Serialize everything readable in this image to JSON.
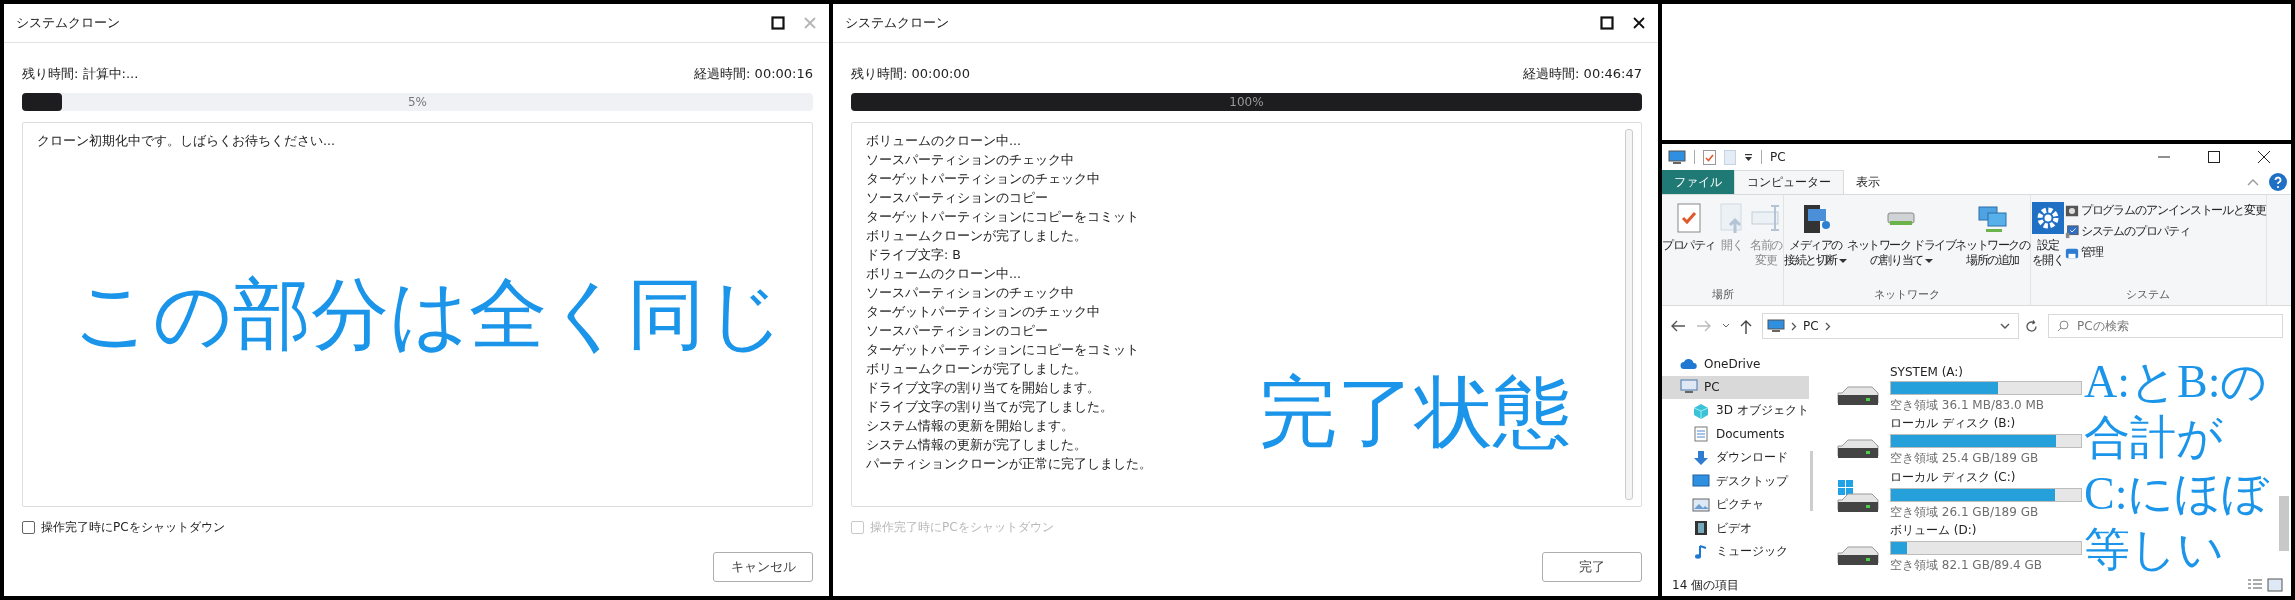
{
  "clone_windows": [
    {
      "title": "システムクローン",
      "close_disabled": true,
      "remaining_label": "残り時間:",
      "remaining_value": "計算中:...",
      "elapsed_label": "経過時間:",
      "elapsed_value": "00:00:16",
      "progress": {
        "level": 0.05,
        "label": "5%"
      },
      "log": [
        "クローン初期化中です。しばらくお待ちください..."
      ],
      "shutdown_option": {
        "label": "操作完了時にPCをシャットダウン",
        "checked": false,
        "disabled": false
      },
      "button": "キャンセル",
      "annotation": "この部分は全く同じ",
      "scrollbar": false
    },
    {
      "title": "システムクローン",
      "close_disabled": false,
      "remaining_label": "残り時間:",
      "remaining_value": "00:00:00",
      "elapsed_label": "経過時間:",
      "elapsed_value": "00:46:47",
      "progress": {
        "level": 1,
        "label": "100%"
      },
      "log": [
        "ボリュームのクローン中...",
        "ソースパーティションのチェック中",
        "ターゲットパーティションのチェック中",
        "ソースパーティションのコピー",
        "ターゲットパーティションにコピーをコミット",
        "ボリュームクローンが完了しました。",
        "ドライブ文字: B",
        "ボリュームのクローン中...",
        "ソースパーティションのチェック中",
        "ターゲットパーティションのチェック中",
        "ソースパーティションのコピー",
        "ターゲットパーティションにコピーをコミット",
        "ボリュームクローンが完了しました。",
        "ドライブ文字の割り当てを開始します。",
        "ドライブ文字の割り当てが完了しました。",
        "システム情報の更新を開始します。",
        "システム情報の更新が完了しました。",
        "パーティションクローンが正常に完了しました。"
      ],
      "shutdown_option": {
        "label": "操作完了時にPCをシャットダウン",
        "checked": false,
        "disabled": true
      },
      "button": "完了",
      "annotation": "完了状態",
      "scrollbar": true
    }
  ],
  "explorer": {
    "title": "PC",
    "tabs": [
      {
        "label": "ファイル",
        "kind": "file",
        "selected": false
      },
      {
        "label": "コンピューター",
        "kind": "tab",
        "selected": true
      },
      {
        "label": "表示",
        "kind": "tab",
        "selected": false
      }
    ],
    "ribbon_groups": [
      {
        "label": "場所",
        "large_items": [
          {
            "lines": [
              "プロパティ"
            ],
            "disabled": false,
            "dropdown": false
          },
          {
            "lines": [
              "開く"
            ],
            "disabled": true,
            "dropdown": false
          },
          {
            "lines": [
              "名前の",
              "変更"
            ],
            "disabled": true,
            "dropdown": false
          }
        ]
      },
      {
        "label": "ネットワーク",
        "large_items": [
          {
            "lines": [
              "メディアの",
              "接続と切断"
            ],
            "disabled": false,
            "dropdown": true
          },
          {
            "lines": [
              "ネットワーク ドライブ",
              "の割り当て"
            ],
            "disabled": false,
            "dropdown": true
          },
          {
            "lines": [
              "ネットワークの",
              "場所の追加"
            ],
            "disabled": false,
            "dropdown": false
          }
        ]
      },
      {
        "label": "システム",
        "large_items": [
          {
            "lines": [
              "設定",
              "を開く"
            ],
            "disabled": false,
            "dropdown": false
          }
        ],
        "small_items": [
          {
            "label": "プログラムのアンインストールと変更"
          },
          {
            "label": "システムのプロパティ"
          },
          {
            "label": "管理"
          }
        ]
      }
    ],
    "path": "PC",
    "search_placeholder": "PCの検索",
    "sidebar": [
      {
        "label": "OneDrive",
        "selected": false
      },
      {
        "label": "PC",
        "selected": true,
        "children": [
          {
            "label": "3D オブジェクト",
            "selected": false
          },
          {
            "label": "Documents",
            "selected": false
          },
          {
            "label": "ダウンロード",
            "selected": false
          },
          {
            "label": "デスクトップ",
            "selected": false
          },
          {
            "label": "ピクチャ",
            "selected": false
          },
          {
            "label": "ビデオ",
            "selected": false
          },
          {
            "label": "ミュージック",
            "selected": false
          }
        ]
      }
    ],
    "drives": [
      {
        "name": "SYSTEM (A:)",
        "kind": "disk",
        "level": 0.565,
        "free": "空き領域 36.1 MB/83.0 MB"
      },
      {
        "name": "ローカル ディスク (B:)",
        "kind": "disk",
        "level": 0.866,
        "free": "空き領域 25.4 GB/189 GB"
      },
      {
        "name": "ローカル ディスク (C:)",
        "kind": "system",
        "level": 0.862,
        "free": "空き領域 26.1 GB/189 GB"
      },
      {
        "name": "ボリューム (D:)",
        "kind": "disk",
        "level": 0.082,
        "free": "空き領域 82.1 GB/89.4 GB"
      }
    ],
    "status": "14 個の項目",
    "annotation": [
      "A:とB:の",
      "合計が",
      "C:にほぼ",
      "等しい"
    ]
  }
}
